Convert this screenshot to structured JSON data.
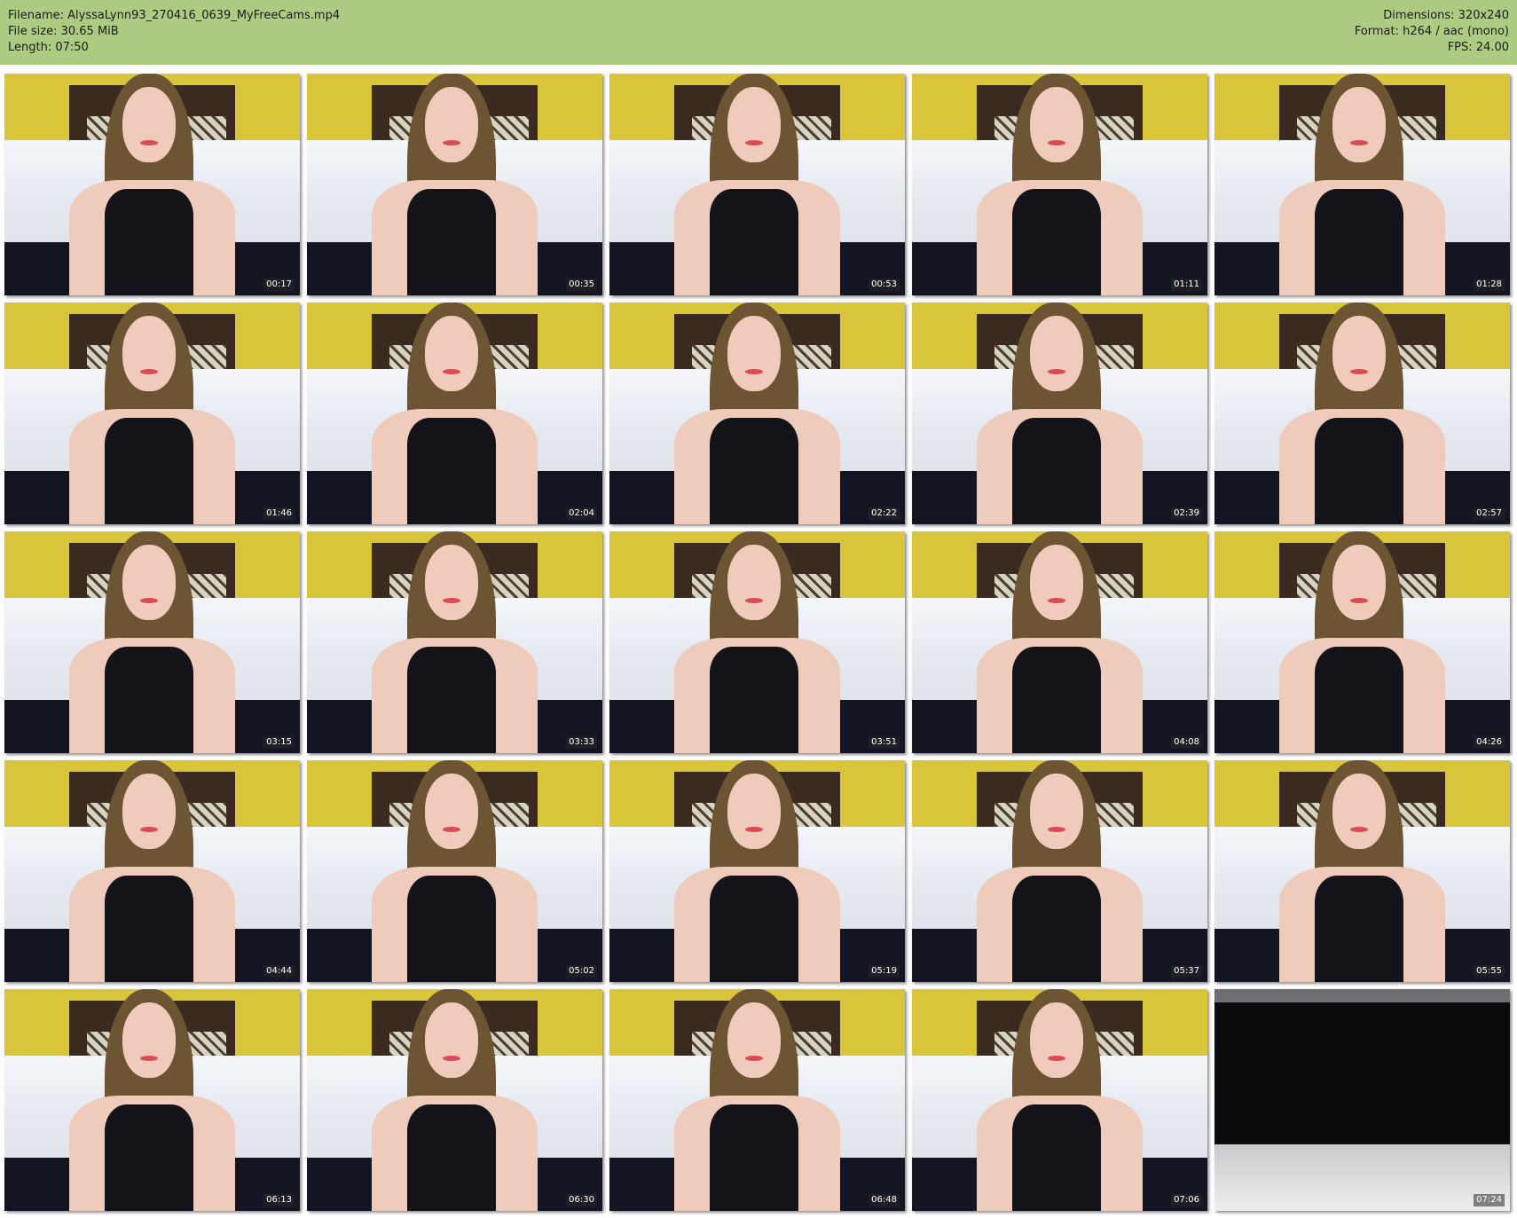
{
  "header": {
    "filename": "Filename: AlyssaLynn93_270416_0639_MyFreeCams.mp4",
    "filesize": "File size: 30.65 MiB",
    "length": "Length: 07:50",
    "dimensions": "Dimensions: 320x240",
    "format": "Format: h264 / aac (mono)",
    "fps": "FPS: 24.00"
  },
  "colors": {
    "header_background": "#aecb82",
    "page_background": "#ffffff"
  },
  "thumbnails": [
    {
      "timestamp": "00:17"
    },
    {
      "timestamp": "00:35"
    },
    {
      "timestamp": "00:53"
    },
    {
      "timestamp": "01:11"
    },
    {
      "timestamp": "01:28"
    },
    {
      "timestamp": "01:46"
    },
    {
      "timestamp": "02:04"
    },
    {
      "timestamp": "02:22"
    },
    {
      "timestamp": "02:39"
    },
    {
      "timestamp": "02:57"
    },
    {
      "timestamp": "03:15"
    },
    {
      "timestamp": "03:33"
    },
    {
      "timestamp": "03:51"
    },
    {
      "timestamp": "04:08"
    },
    {
      "timestamp": "04:26"
    },
    {
      "timestamp": "04:44"
    },
    {
      "timestamp": "05:02"
    },
    {
      "timestamp": "05:19"
    },
    {
      "timestamp": "05:37"
    },
    {
      "timestamp": "05:55"
    },
    {
      "timestamp": "06:13"
    },
    {
      "timestamp": "06:30"
    },
    {
      "timestamp": "06:48"
    },
    {
      "timestamp": "07:06"
    },
    {
      "timestamp": "07:24",
      "dark": true
    }
  ]
}
